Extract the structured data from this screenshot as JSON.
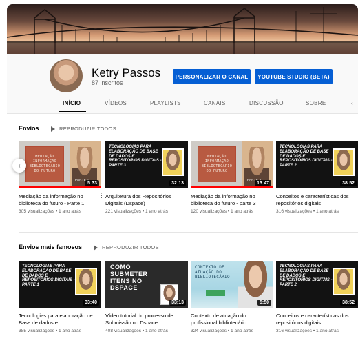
{
  "channel": {
    "name": "Ketry Passos",
    "subscribers": "87 inscritos",
    "customize_label": "PERSONALIZAR O CANAL",
    "studio_label": "YOUTUBE STUDIO (BETA)"
  },
  "tabs": [
    {
      "label": "INÍCIO",
      "active": true
    },
    {
      "label": "VÍDEOS"
    },
    {
      "label": "PLAYLISTS"
    },
    {
      "label": "CANAIS"
    },
    {
      "label": "DISCUSSÃO"
    },
    {
      "label": "SOBRE"
    }
  ],
  "colors": {
    "accent": "#065fd4",
    "progress": "#ff0000"
  },
  "shelves": [
    {
      "title": "Envios",
      "play_all": "REPRODUZIR TODOS",
      "videos": [
        {
          "thumb_text": "MEDIAÇÃO\nINFORMAÇÃO\nBIBLIOTECÁRIO\nDO FUTURO",
          "thumb_sub": "PARTE 1",
          "duration": "5:33",
          "title": "Mediação da informação no biblioteca do futuro - Parte 1",
          "meta": "305 visualizações • 1 ano atrás"
        },
        {
          "thumb_text": "TECNOLOGIAS PARA ELABORAÇÃO DE BASE DE DADOS E REPOSITÓRIOS DIGITAIS - PARTE 3",
          "duration": "32:13",
          "title": "Arquitetura dos Repositórios Digitais (Dspace)",
          "meta": "221 visualizações • 1 ano atrás"
        },
        {
          "thumb_text": "MEDIAÇÃO\nINFORMAÇÃO\nBIBLIOTECÁRIO\nDO FUTURO",
          "thumb_sub": "PARTE 3",
          "duration": "13:47",
          "title": "Mediação da informação no biblioteca do futuro - parte 3",
          "meta": "120 visualizações • 1 ano atrás"
        },
        {
          "thumb_text": "TECNOLOGIAS PARA ELABORAÇÃO DE BASE DE DADOS E REPOSITÓRIOS DIGITAIS - PARTE 2",
          "duration": "38:52",
          "title": "Conceitos e características dos repositórios digitais",
          "meta": "316 visualizações • 1 ano atrás"
        }
      ]
    },
    {
      "title": "Envios mais famosos",
      "play_all": "REPRODUZIR TODOS",
      "videos": [
        {
          "thumb_text": "TECNOLOGIAS PARA ELABORAÇÃO DE BASE DE DADOS E REPOSITÓRIOS DIGITAIS - PARTE 1",
          "duration": "33:40",
          "title": "Tecnologias para elaboração de Base de dados e...",
          "meta": "385 visualizações • 1 ano atrás"
        },
        {
          "thumb_text": "COMO\nSUBMETER\nITENS NO\nDSPACE",
          "duration": "33:13",
          "title": "Vídeo tutorial do processo de Submissão no Dspace",
          "meta": "408 visualizações • 1 ano atrás"
        },
        {
          "thumb_text": "CONTEXTO DE\nATUAÇÃO DO\nBIBLIOTECÁRIO",
          "duration": "5:50",
          "title": "Contexto de atuação do profissional bibliotecário...",
          "meta": "324 visualizações • 1 ano atrás"
        },
        {
          "thumb_text": "TECNOLOGIAS PARA ELABORAÇÃO DE BASE DE DADOS E REPOSITÓRIOS DIGITAIS - PARTE 2",
          "duration": "38:52",
          "title": "Conceitos e características dos repositórios digitais",
          "meta": "316 visualizações • 1 ano atrás"
        }
      ]
    }
  ]
}
